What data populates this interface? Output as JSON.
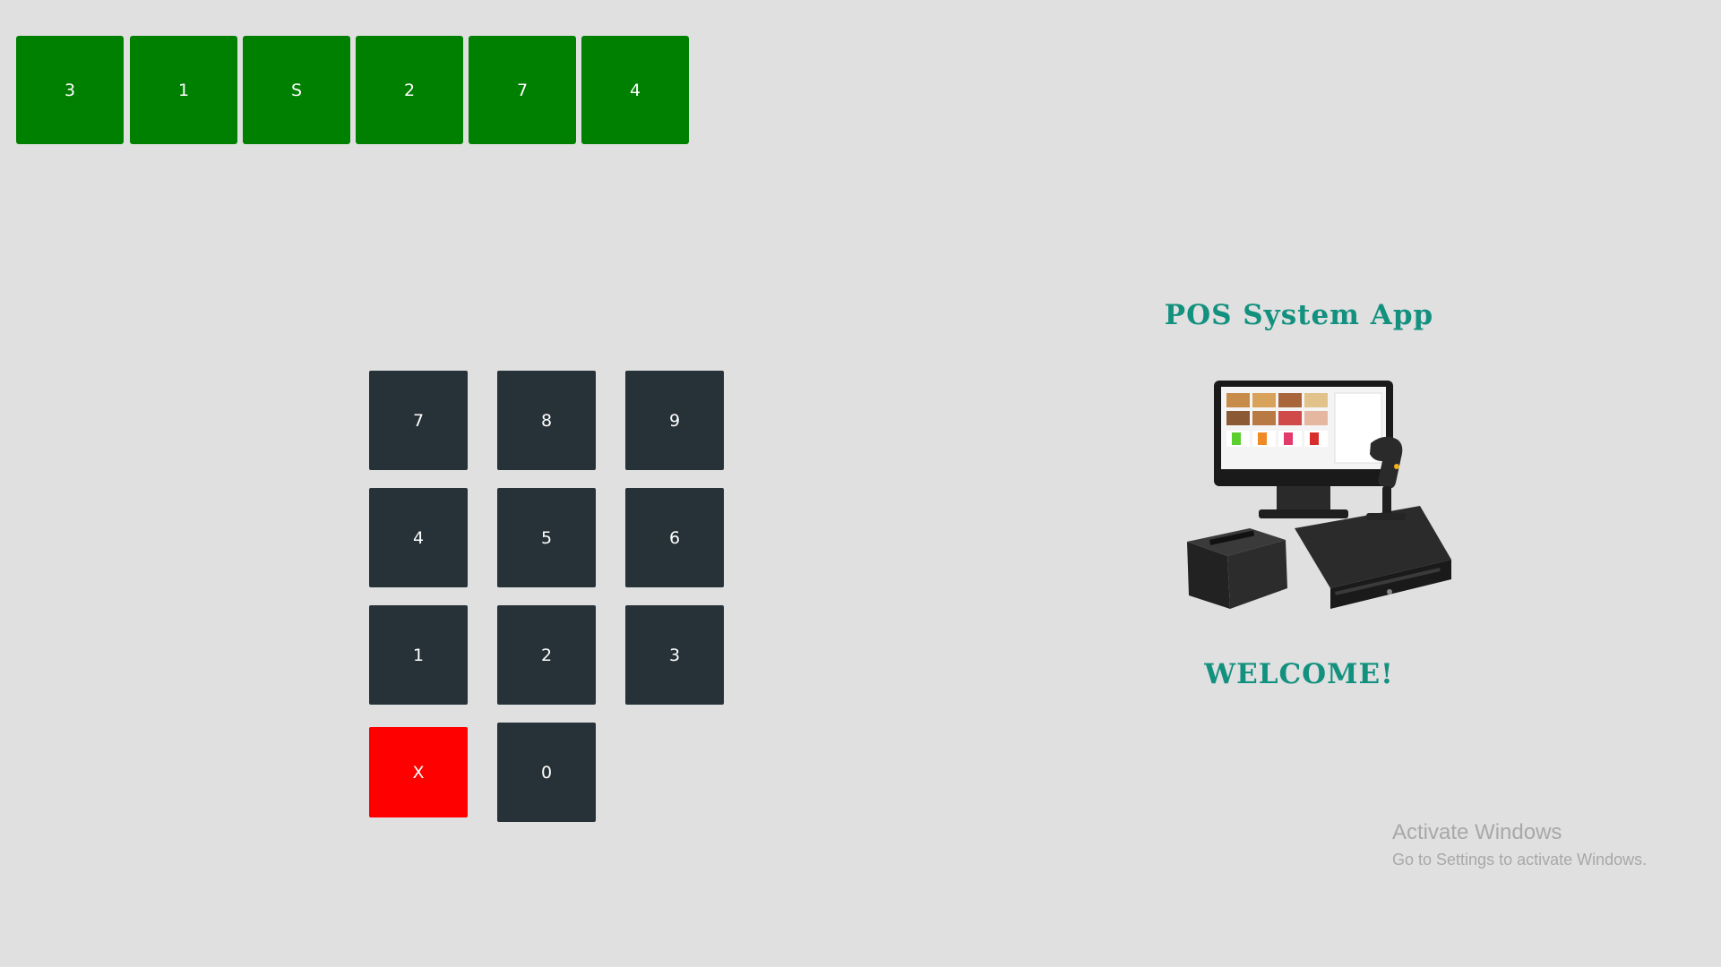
{
  "pin_display": [
    "3",
    "1",
    "S",
    "2",
    "7",
    "4"
  ],
  "keypad": {
    "rows": [
      [
        "7",
        "8",
        "9"
      ],
      [
        "4",
        "5",
        "6"
      ],
      [
        "1",
        "2",
        "3"
      ]
    ],
    "clear_label": "X",
    "zero_label": "0"
  },
  "branding": {
    "title": "POS System App",
    "welcome": "WELCOME!",
    "illustration": "pos-terminal-illustration"
  },
  "watermark": {
    "title": "Activate Windows",
    "subtitle": "Go to Settings to activate Windows."
  },
  "colors": {
    "background": "#e0e0e0",
    "pin_slot": "#008000",
    "key": "#263238",
    "clear_key": "#ff0000",
    "brand_text": "#13917f",
    "watermark_text": "#a8a8a8"
  }
}
